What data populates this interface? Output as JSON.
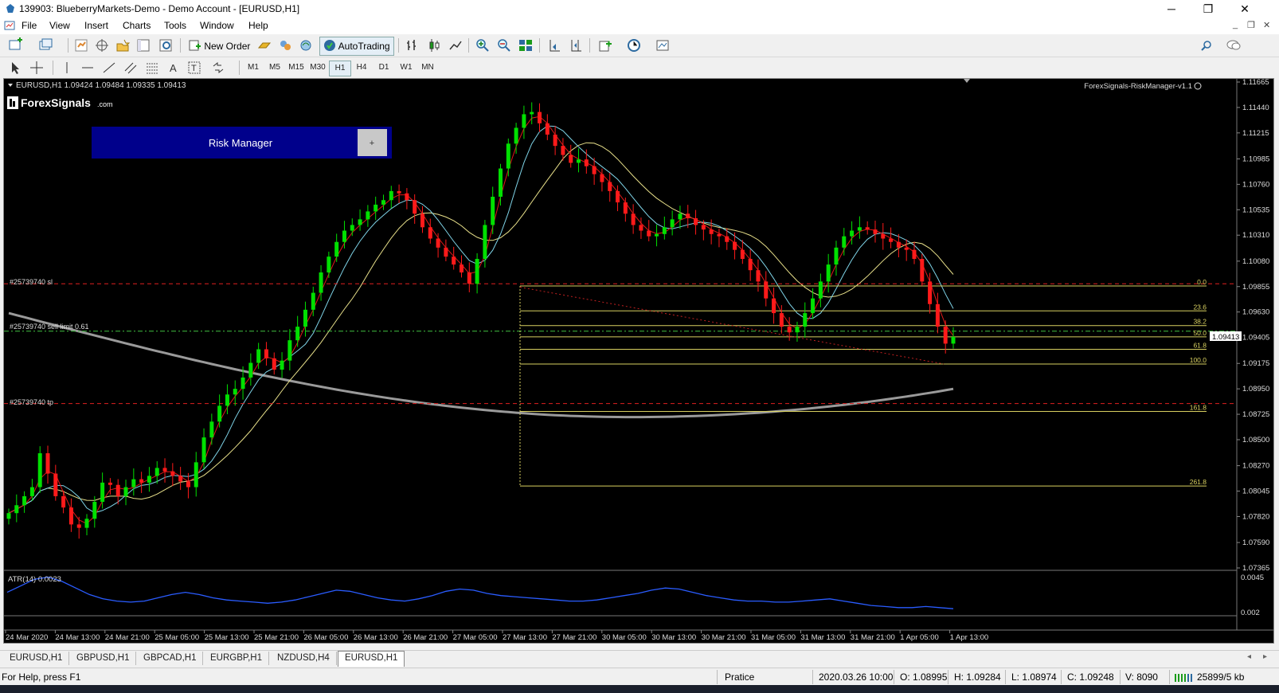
{
  "window": {
    "title": "139903: BlueberryMarkets-Demo - Demo Account - [EURUSD,H1]",
    "minimize": "─",
    "restore": "❐",
    "close": "✕"
  },
  "menu": [
    "File",
    "View",
    "Insert",
    "Charts",
    "Tools",
    "Window",
    "Help"
  ],
  "toolbar": {
    "new_order": "New Order",
    "autotrading": "AutoTrading",
    "timeframes": [
      "M1",
      "M5",
      "M15",
      "M30",
      "H1",
      "H4",
      "D1",
      "W1",
      "MN"
    ],
    "active_timeframe": "H1"
  },
  "chart": {
    "header": "EURUSD,H1  1.09424 1.09484 1.09335 1.09413",
    "logo_text": "ForexSignals",
    "logo_suffix": ".com",
    "indicator_name": "ForexSignals-RiskManager-v1.1",
    "risk_manager_label": "Risk Manager",
    "risk_manager_btn": "+",
    "order_lines": {
      "sl": "#25739740 sl",
      "sell_limit": "#25739740 sell limit 0.61",
      "tp": "#25739740 tp"
    },
    "fib_labels": [
      "0.0",
      "23.6",
      "38.2",
      "50.0",
      "61.8",
      "100.0",
      "161.8",
      "261.8"
    ],
    "current_price": "1.09413",
    "atr_label": "ATR(14) 0.0023",
    "atr_scale": [
      "0.0045",
      "0.002"
    ]
  },
  "chart_data": {
    "type": "candlestick",
    "symbol": "EURUSD",
    "timeframe": "H1",
    "y_ticks": [
      "1.11665",
      "1.11440",
      "1.11215",
      "1.10985",
      "1.10760",
      "1.10535",
      "1.10310",
      "1.10080",
      "1.09855",
      "1.09630",
      "1.09405",
      "1.09175",
      "1.08950",
      "1.08725",
      "1.08500",
      "1.08270",
      "1.08045",
      "1.07820",
      "1.07590",
      "1.07365"
    ],
    "ylim": [
      1.07365,
      1.11665
    ],
    "x_ticks": [
      "24 Mar 2020",
      "24 Mar 13:00",
      "24 Mar 21:00",
      "25 Mar 05:00",
      "25 Mar 13:00",
      "25 Mar 21:00",
      "26 Mar 05:00",
      "26 Mar 13:00",
      "26 Mar 21:00",
      "27 Mar 05:00",
      "27 Mar 13:00",
      "27 Mar 21:00",
      "30 Mar 05:00",
      "30 Mar 13:00",
      "30 Mar 21:00",
      "31 Mar 05:00",
      "31 Mar 13:00",
      "31 Mar 21:00",
      "1 Apr 05:00",
      "1 Apr 13:00"
    ],
    "ohlc": {
      "open": 1.09424,
      "high": 1.09484,
      "low": 1.09335,
      "close": 1.09413
    },
    "levels": {
      "sl": 1.0988,
      "sell_limit": 1.0946,
      "tp": 1.0882
    },
    "fib": [
      {
        "label": "0.0",
        "price": 1.0986
      },
      {
        "label": "23.6",
        "price": 1.0964
      },
      {
        "label": "38.2",
        "price": 1.0951
      },
      {
        "label": "50.0",
        "price": 1.0941
      },
      {
        "label": "61.8",
        "price": 1.093
      },
      {
        "label": "100.0",
        "price": 1.0917
      },
      {
        "label": "161.8",
        "price": 1.0875
      },
      {
        "label": "261.8",
        "price": 1.0809
      }
    ],
    "close_series": [
      1.0785,
      1.0792,
      1.08,
      1.0808,
      1.0838,
      1.082,
      1.08,
      1.079,
      1.0775,
      1.0772,
      1.078,
      1.0795,
      1.0812,
      1.081,
      1.08,
      1.0808,
      1.0815,
      1.0812,
      1.0818,
      1.0825,
      1.0822,
      1.0818,
      1.0813,
      1.0808,
      1.083,
      1.0852,
      1.0866,
      1.088,
      1.089,
      1.0895,
      1.0905,
      1.0918,
      1.093,
      1.0922,
      1.0912,
      1.092,
      1.0938,
      1.095,
      1.0965,
      1.098,
      1.0998,
      1.1012,
      1.1025,
      1.1035,
      1.104,
      1.1045,
      1.1052,
      1.1058,
      1.1062,
      1.107,
      1.1068,
      1.1062,
      1.105,
      1.1038,
      1.1028,
      1.102,
      1.1012,
      1.1005,
      1.0998,
      1.0988,
      1.101,
      1.104,
      1.1065,
      1.109,
      1.1112,
      1.1126,
      1.1138,
      1.114,
      1.113,
      1.112,
      1.111,
      1.1102,
      1.1095,
      1.1098,
      1.1092,
      1.1085,
      1.1078,
      1.107,
      1.106,
      1.105,
      1.104,
      1.1035,
      1.103,
      1.1032,
      1.1038,
      1.1045,
      1.105,
      1.1046,
      1.104,
      1.1036,
      1.1032,
      1.103,
      1.1025,
      1.1018,
      1.101,
      1.1,
      1.099,
      1.0975,
      1.0962,
      1.095,
      1.0945,
      1.095,
      1.0962,
      1.0975,
      1.099,
      1.1005,
      1.102,
      1.103,
      1.1035,
      1.1038,
      1.1036,
      1.1032,
      1.1028,
      1.1025,
      1.102,
      1.1018,
      1.101,
      1.099,
      1.097,
      1.095,
      1.0935,
      1.0941
    ],
    "atr_series": [
      0.003,
      0.0036,
      0.0042,
      0.0044,
      0.004,
      0.0034,
      0.0028,
      0.0024,
      0.0022,
      0.0021,
      0.0022,
      0.0025,
      0.0028,
      0.003,
      0.0028,
      0.0025,
      0.0023,
      0.0022,
      0.0021,
      0.002,
      0.0021,
      0.0023,
      0.0026,
      0.0029,
      0.0032,
      0.0031,
      0.0028,
      0.0025,
      0.0023,
      0.0022,
      0.0024,
      0.0027,
      0.0031,
      0.0033,
      0.0032,
      0.0029,
      0.0027,
      0.0026,
      0.0025,
      0.0024,
      0.0023,
      0.0022,
      0.0022,
      0.0023,
      0.0025,
      0.0027,
      0.0029,
      0.0032,
      0.0034,
      0.0033,
      0.003,
      0.0027,
      0.0025,
      0.0023,
      0.0022,
      0.0022,
      0.0021,
      0.0021,
      0.0022,
      0.0023,
      0.0024,
      0.0022,
      0.002,
      0.0018,
      0.0017,
      0.0016,
      0.0016,
      0.0017,
      0.0016,
      0.0015
    ]
  },
  "tabs": [
    "EURUSD,H1",
    "GBPUSD,H1",
    "GBPCAD,H1",
    "EURGBP,H1",
    "NZDUSD,H4",
    "EURUSD,H1"
  ],
  "status": {
    "help": "For Help, press F1",
    "profile": "Pratice",
    "datetime": "2020.03.26 10:00",
    "open": "O: 1.08995",
    "high": "H: 1.09284",
    "low": "L: 1.08974",
    "close": "C: 1.09248",
    "volume": "V: 8090",
    "traffic": "25899/5 kb"
  }
}
